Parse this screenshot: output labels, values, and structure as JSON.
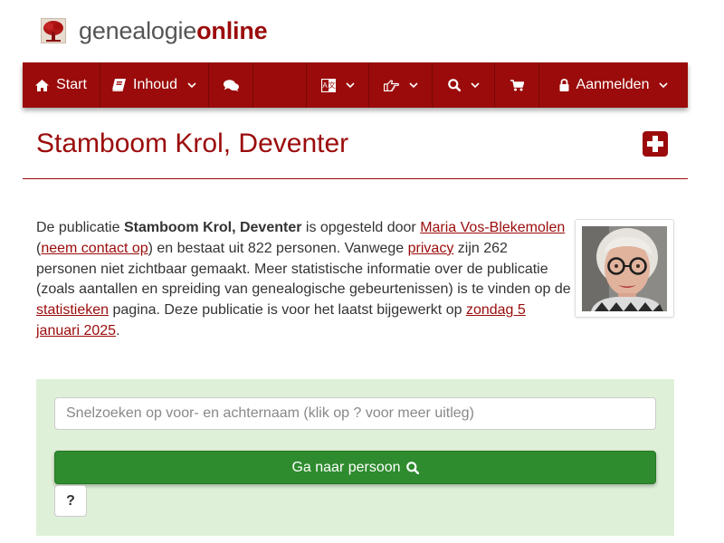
{
  "brand": {
    "name_part1": "genealogie",
    "name_part2": "online",
    "primary_color": "#9b0b0b",
    "logo_icon": "tree-icon"
  },
  "navbar": {
    "start_label": "Start",
    "contents_label": "Inhoud",
    "login_label": "Aanmelden",
    "icons": [
      "home-icon",
      "book-icon",
      "comments-icon",
      "language-icon",
      "hand-point-icon",
      "search-icon",
      "cart-icon",
      "lock-icon"
    ]
  },
  "page": {
    "title": "Stamboom Krol, Deventer"
  },
  "intro": {
    "t1": "De publicatie ",
    "publication": "Stamboom Krol, Deventer",
    "t2": " is opgesteld door ",
    "author": "Maria Vos-Blekemolen",
    "t3": " (",
    "contact": "neem contact op",
    "t4": ") en bestaat uit 822 personen. Vanwege ",
    "privacy": "privacy",
    "t5": " zijn 262 personen niet zichtbaar gemaakt. Meer statistische informatie over de publicatie (zoals aantallen en spreiding van genealogische gebeurtenissen) is te vinden op de ",
    "stats": "statistieken",
    "t6": " pagina. Deze publicatie is voor het laatst bijgewerkt op ",
    "date": "zondag 5 januari 2025",
    "t7": "."
  },
  "search": {
    "placeholder": "Snelzoeken op voor- en achternaam (klik op ? voor meer uitleg)",
    "button_label": "Ga naar persoon",
    "help_label": "?",
    "panel_color": "#dff0d8",
    "button_color": "#2e8b2e"
  }
}
